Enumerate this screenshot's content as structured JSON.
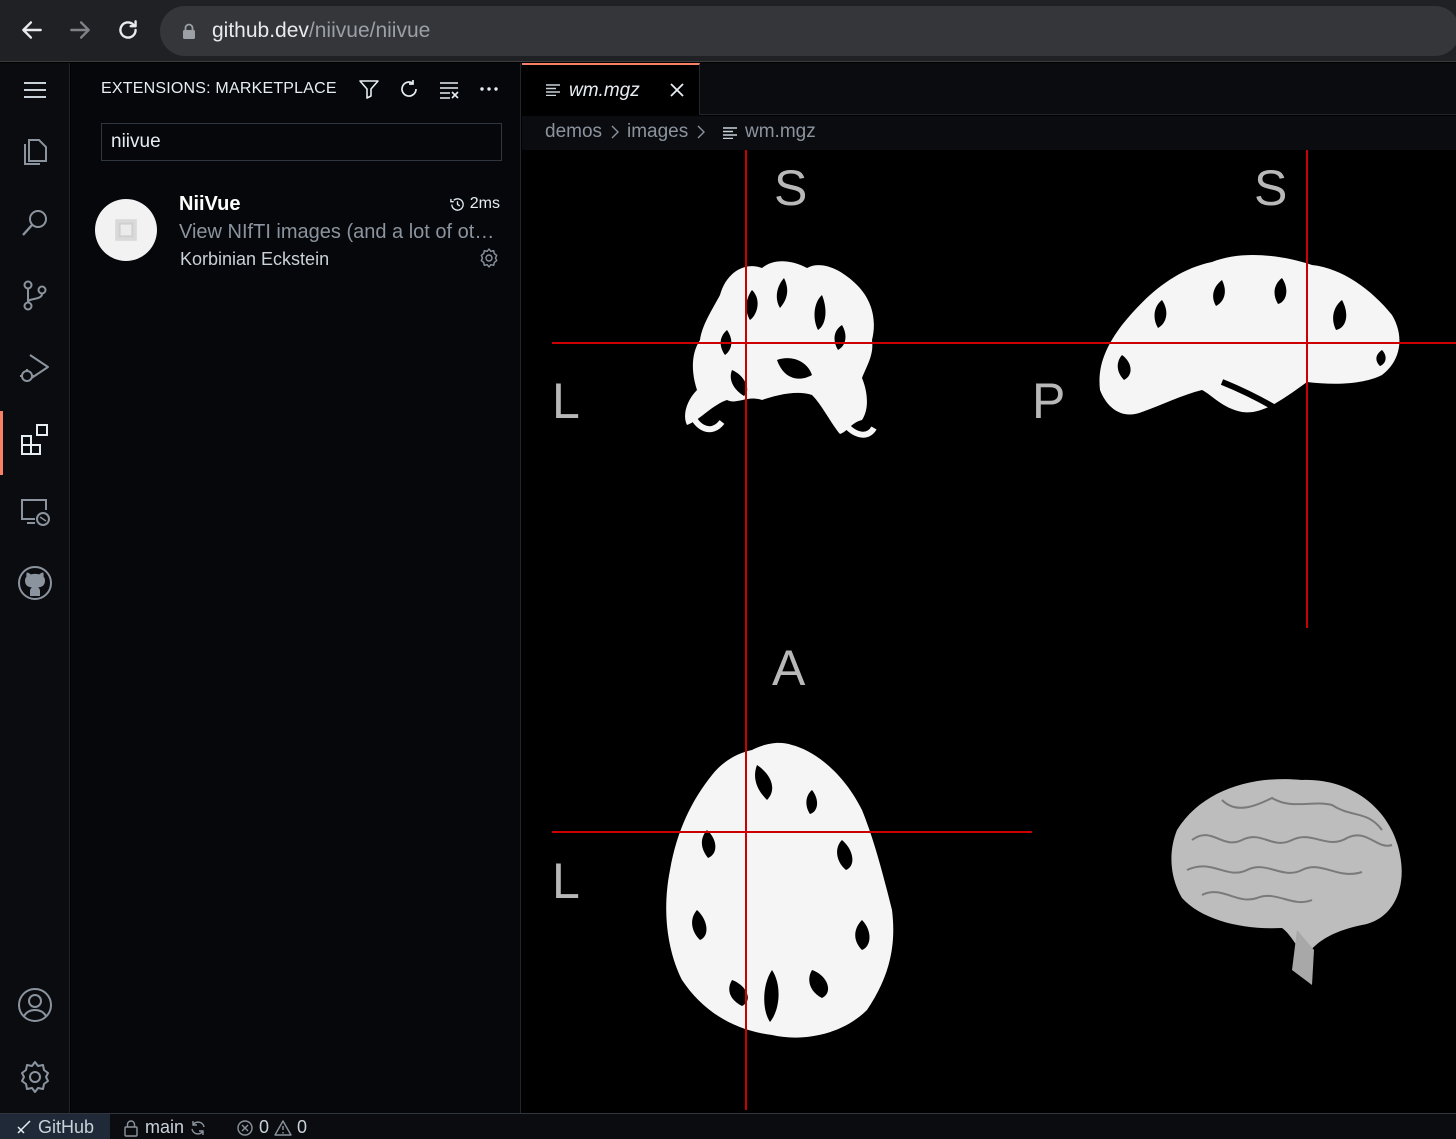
{
  "browser": {
    "url_host": "github.dev",
    "url_path": "/niivue/niivue"
  },
  "activity_bar": {
    "items": [
      "menu-icon",
      "explorer-icon",
      "search-icon",
      "source-control-icon",
      "run-debug-icon",
      "extensions-icon",
      "remote-explorer-icon",
      "github-icon",
      "accounts-icon",
      "settings-gear-icon"
    ],
    "active": "extensions-icon",
    "accent_color": "#f78166"
  },
  "sidebar": {
    "title": "EXTENSIONS: MARKETPLACE",
    "actions": [
      "filter-icon",
      "refresh-icon",
      "clear-results-icon",
      "more-actions-icon"
    ],
    "search_value": "niivue",
    "extension": {
      "name": "NiiVue",
      "activation_time": "2ms",
      "description": "View NIfTI images (and a lot of other formats)",
      "author": "Korbinian Eckstein"
    }
  },
  "editor": {
    "tab_label": "wm.mgz",
    "breadcrumb": [
      "demos",
      "images",
      "wm.mgz"
    ],
    "viewer": {
      "coronal": {
        "top": "S",
        "left": "L"
      },
      "sagittal": {
        "top": "S",
        "left": "P"
      },
      "axial": {
        "top": "A",
        "left": "L"
      },
      "crosshair_color": "#cc0000"
    }
  },
  "statusbar": {
    "remote": "GitHub",
    "branch": "main",
    "errors": "0",
    "warnings": "0"
  }
}
